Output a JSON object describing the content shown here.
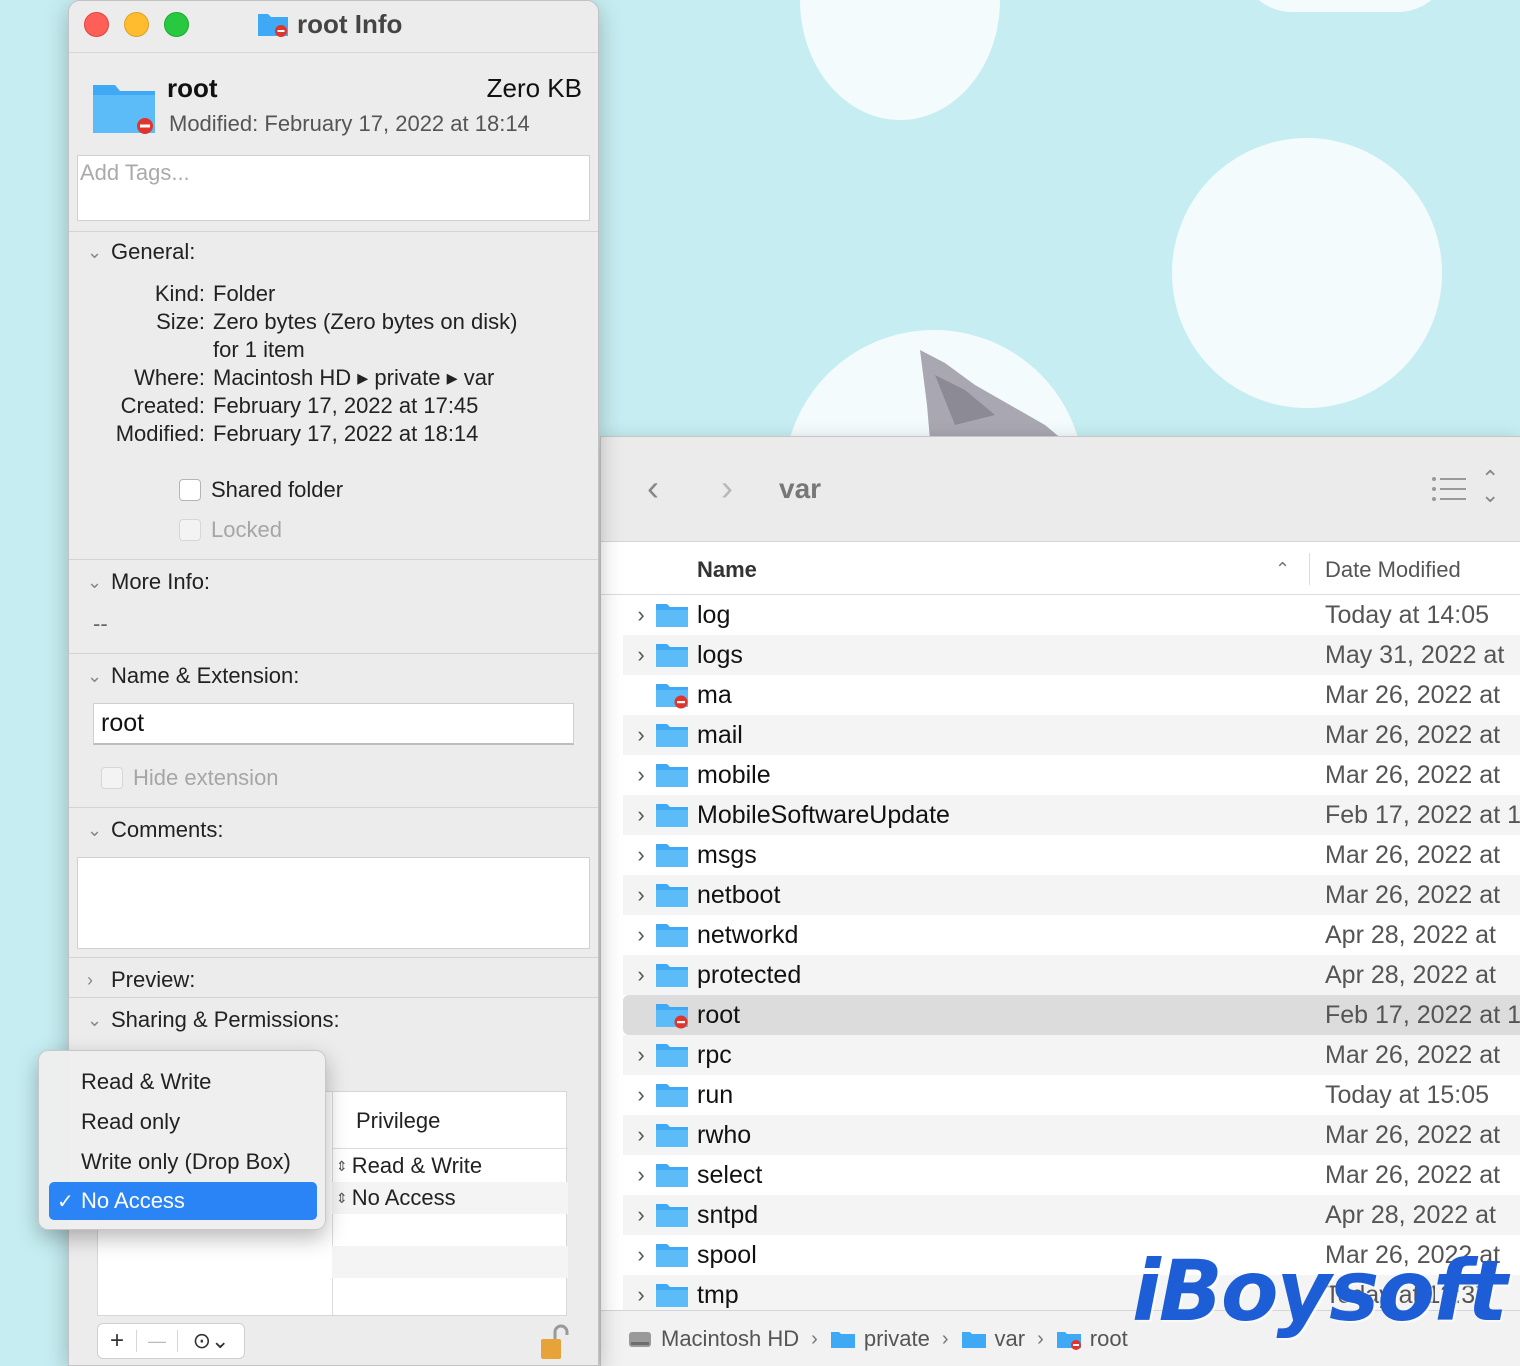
{
  "info_window": {
    "title": "root Info",
    "header": {
      "name": "root",
      "size": "Zero KB",
      "modified": "Modified:  February 17, 2022 at 18:14"
    },
    "tags_placeholder": "Add Tags...",
    "general": {
      "heading": "General:",
      "fields": [
        {
          "key": "Kind:",
          "value": "Folder"
        },
        {
          "key": "Size:",
          "value": "Zero bytes (Zero bytes on disk)"
        },
        {
          "key": "",
          "value": "for 1 item"
        },
        {
          "key": "Where:",
          "value": "Macintosh HD ▸ private ▸ var"
        },
        {
          "key": "Created:",
          "value": "February 17, 2022 at 17:45"
        },
        {
          "key": "Modified:",
          "value": "February 17, 2022 at 18:14"
        }
      ],
      "shared_folder": "Shared folder",
      "locked": "Locked"
    },
    "more_info": {
      "heading": "More Info:",
      "value": "--"
    },
    "name_ext": {
      "heading": "Name & Extension:",
      "value": "root",
      "hide_extension": "Hide extension"
    },
    "comments": {
      "heading": "Comments:"
    },
    "preview": {
      "heading": "Preview:"
    },
    "sharing": {
      "heading": "Sharing & Permissions:",
      "column": "Privilege",
      "rows": [
        "Read & Write",
        "No Access"
      ]
    },
    "bottom_bar": {
      "add": "+",
      "remove": "—",
      "action": "⊙⌄"
    }
  },
  "privilege_menu": {
    "items": [
      "Read & Write",
      "Read only",
      "Write only (Drop Box)",
      "No Access"
    ],
    "selected": "No Access",
    "check": "✓"
  },
  "finder": {
    "location": "var",
    "columns": {
      "name": "Name",
      "date": "Date Modified"
    },
    "rows": [
      {
        "name": "log",
        "date": "Today at 14:05",
        "restricted": false
      },
      {
        "name": "logs",
        "date": "May 31, 2022 at",
        "restricted": false
      },
      {
        "name": "ma",
        "date": "Mar 26, 2022 at",
        "restricted": true
      },
      {
        "name": "mail",
        "date": "Mar 26, 2022 at",
        "restricted": false
      },
      {
        "name": "mobile",
        "date": "Mar 26, 2022 at",
        "restricted": false
      },
      {
        "name": "MobileSoftwareUpdate",
        "date": "Feb 17, 2022 at 1",
        "restricted": false
      },
      {
        "name": "msgs",
        "date": "Mar 26, 2022 at",
        "restricted": false
      },
      {
        "name": "netboot",
        "date": "Mar 26, 2022 at",
        "restricted": false
      },
      {
        "name": "networkd",
        "date": "Apr 28, 2022 at",
        "restricted": false
      },
      {
        "name": "protected",
        "date": "Apr 28, 2022 at",
        "restricted": false
      },
      {
        "name": "root",
        "date": "Feb 17, 2022 at 1",
        "restricted": true,
        "selected": true
      },
      {
        "name": "rpc",
        "date": "Mar 26, 2022 at",
        "restricted": false
      },
      {
        "name": "run",
        "date": "Today at 15:05",
        "restricted": false
      },
      {
        "name": "rwho",
        "date": "Mar 26, 2022 at",
        "restricted": false
      },
      {
        "name": "select",
        "date": "Mar 26, 2022 at",
        "restricted": false
      },
      {
        "name": "sntpd",
        "date": "Apr 28, 2022 at",
        "restricted": false
      },
      {
        "name": "spool",
        "date": "Mar 26, 2022 at",
        "restricted": false
      },
      {
        "name": "tmp",
        "date": "Today at 13:37",
        "restricted": false
      }
    ],
    "path": [
      "Macintosh HD",
      "private",
      "var",
      "root"
    ]
  },
  "watermark": "iBoysoft",
  "colors": {
    "folder": "#3fa9f5",
    "selection": "#2b84f5",
    "close": "#fe5f57",
    "minimize": "#febc2e",
    "maximize": "#28c840"
  }
}
